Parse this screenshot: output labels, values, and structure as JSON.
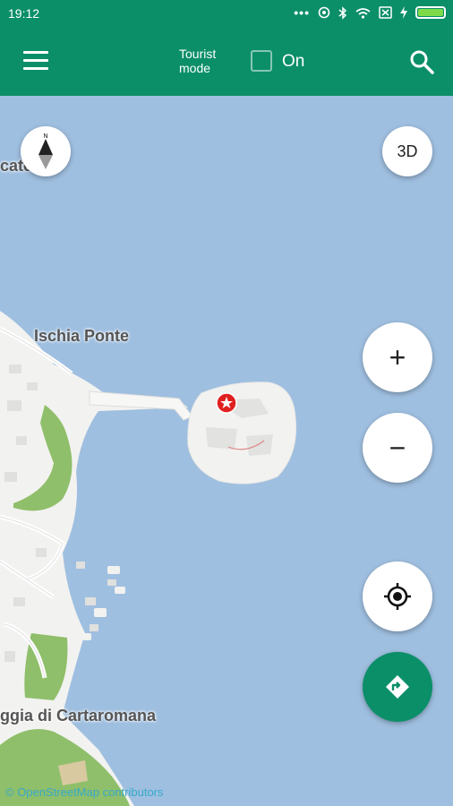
{
  "status_bar": {
    "time": "19:12",
    "icons": [
      "more-dots-icon",
      "alarm-icon",
      "bluetooth-icon",
      "wifi-icon",
      "sim-x-icon",
      "charging-icon",
      "battery-icon"
    ]
  },
  "app_bar": {
    "tourist_mode_label": "Tourist\nmode",
    "toggle_label": "On",
    "toggle_checked": false,
    "background_color": "#0b8f69"
  },
  "map": {
    "labels": {
      "partial_top_left": "cate",
      "ischia_ponte": "Ischia Ponte",
      "cartaromana": "ggia di Cartaromana"
    },
    "controls": {
      "view_3d_label": "3D",
      "zoom_in_label": "+",
      "zoom_out_label": "−"
    },
    "attribution": "© OpenStreetMap contributors",
    "colors": {
      "sea": "#9fbfe0",
      "land": "#f2f2f0",
      "park": "#8fbf6a",
      "accent": "#0b8f69",
      "marker": "#e02020"
    }
  }
}
